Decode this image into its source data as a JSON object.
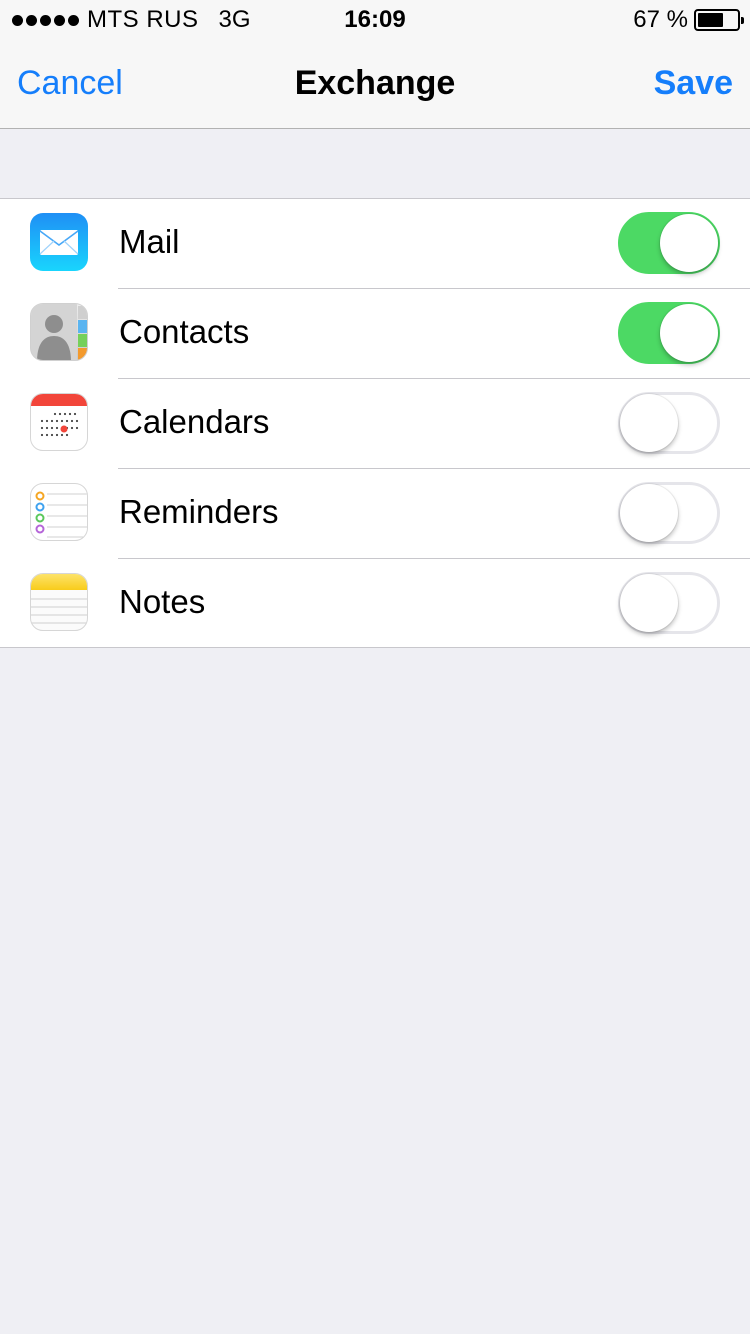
{
  "status_bar": {
    "carrier": "MTS RUS",
    "network": "3G",
    "time": "16:09",
    "battery_percent_text": "67 %",
    "battery_level": 0.67,
    "signal_bars": 5
  },
  "nav": {
    "cancel_label": "Cancel",
    "title": "Exchange",
    "save_label": "Save"
  },
  "accent_colors": {
    "link": "#157efb",
    "toggle_on": "#4cd964",
    "background": "#efeff4"
  },
  "settings": [
    {
      "label": "Mail",
      "icon": "mail-icon",
      "enabled": true
    },
    {
      "label": "Contacts",
      "icon": "contacts-icon",
      "enabled": true
    },
    {
      "label": "Calendars",
      "icon": "calendar-icon",
      "enabled": false
    },
    {
      "label": "Reminders",
      "icon": "reminders-icon",
      "enabled": false
    },
    {
      "label": "Notes",
      "icon": "notes-icon",
      "enabled": false
    }
  ]
}
